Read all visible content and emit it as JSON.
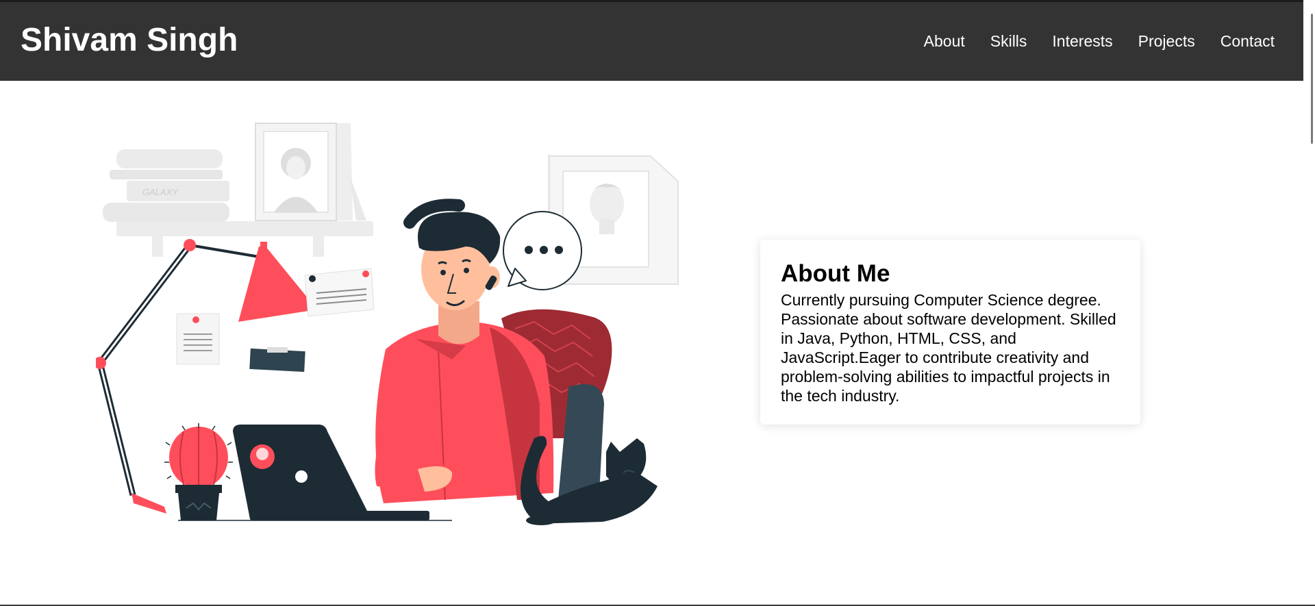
{
  "header": {
    "brand": "Shivam Singh",
    "nav": [
      {
        "label": "About"
      },
      {
        "label": "Skills"
      },
      {
        "label": "Interests"
      },
      {
        "label": "Projects"
      },
      {
        "label": "Contact"
      }
    ]
  },
  "hero": {
    "illustration": {
      "book_spine_text": "GALAXY",
      "icon": "person-working-on-laptop-illustration"
    }
  },
  "about": {
    "title": "About Me",
    "body": "Currently pursuing Computer Science degree. Passionate about software development. Skilled in Java, Python, HTML, CSS, and JavaScript.Eager to contribute creativity and problem-solving abilities to impactful projects in the tech industry."
  },
  "colors": {
    "header_bg": "#333333",
    "accent_red": "#ff4e5b",
    "dark_navy": "#1d2b34",
    "skin": "#ffbf9d"
  }
}
